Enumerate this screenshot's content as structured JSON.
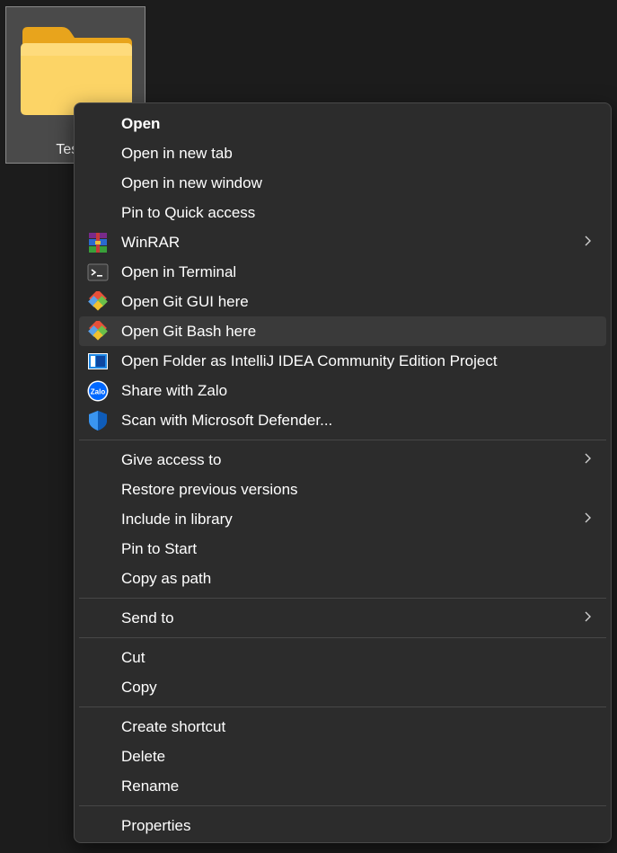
{
  "desktop": {
    "folder_label": "Test"
  },
  "menu": {
    "groups": [
      [
        {
          "label": "Open",
          "bold": true
        },
        {
          "label": "Open in new tab"
        },
        {
          "label": "Open in new window"
        },
        {
          "label": "Pin to Quick access"
        },
        {
          "label": "WinRAR",
          "icon": "winrar-icon",
          "submenu": true
        },
        {
          "label": "Open in Terminal",
          "icon": "terminal-icon"
        },
        {
          "label": "Open Git GUI here",
          "icon": "git-gui-icon"
        },
        {
          "label": "Open Git Bash here",
          "icon": "git-bash-icon",
          "hovered": true
        },
        {
          "label": "Open Folder as IntelliJ IDEA Community Edition Project",
          "icon": "intellij-icon"
        },
        {
          "label": "Share with Zalo",
          "icon": "zalo-icon"
        },
        {
          "label": "Scan with Microsoft Defender...",
          "icon": "defender-shield-icon"
        }
      ],
      [
        {
          "label": "Give access to",
          "submenu": true
        },
        {
          "label": "Restore previous versions"
        },
        {
          "label": "Include in library",
          "submenu": true
        },
        {
          "label": "Pin to Start"
        },
        {
          "label": "Copy as path"
        }
      ],
      [
        {
          "label": "Send to",
          "submenu": true
        }
      ],
      [
        {
          "label": "Cut"
        },
        {
          "label": "Copy"
        }
      ],
      [
        {
          "label": "Create shortcut"
        },
        {
          "label": "Delete"
        },
        {
          "label": "Rename"
        }
      ],
      [
        {
          "label": "Properties"
        }
      ]
    ]
  },
  "icons": {
    "zalo_text": "Zalo"
  },
  "colors": {
    "menu_bg": "#2c2c2c",
    "hover_bg": "#3a3a3a",
    "folder_yellow": "#f7c948",
    "zalo_blue": "#0068ff",
    "defender_blue": "#1a73d9"
  }
}
